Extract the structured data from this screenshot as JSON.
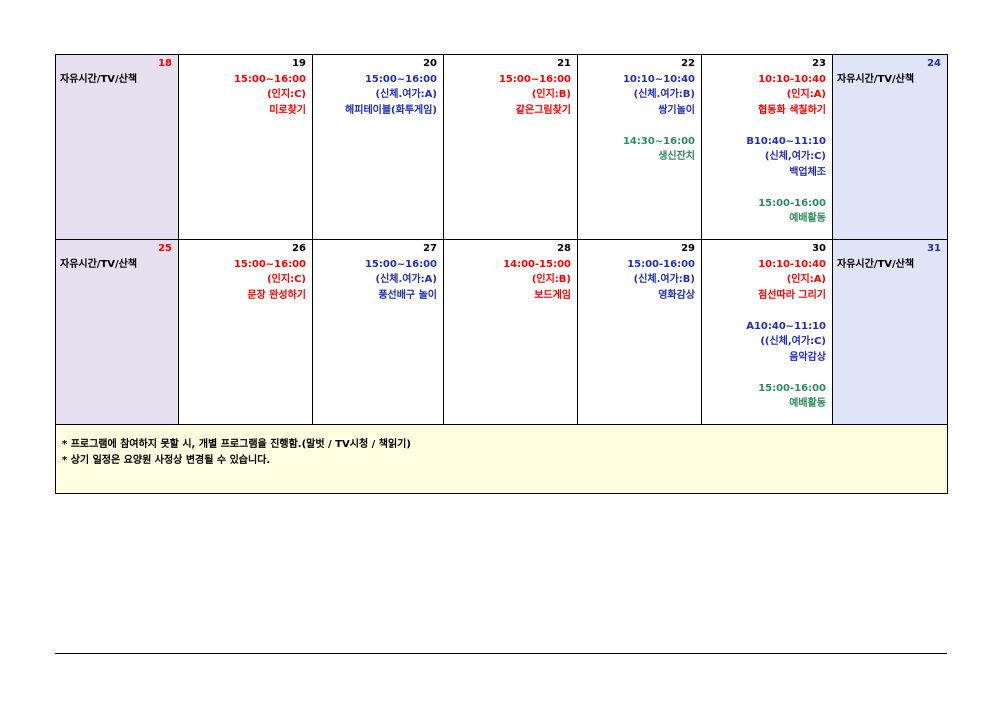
{
  "colors": {
    "red": "#ff0000",
    "blue": "#1f2fb5",
    "green": "#2e8a5a",
    "sunday_bg": "#e6dff0",
    "saturday_bg": "#dfe4f7",
    "note_bg": "#fdfde0"
  },
  "weeks": [
    {
      "days": [
        {
          "num": "18",
          "num_color": "#ff0000",
          "type": "sun",
          "lines": [
            {
              "text": "자유시간/TV/산책",
              "color": "#000000"
            }
          ]
        },
        {
          "num": "19",
          "num_color": "#000000",
          "type": "day",
          "lines": [
            {
              "text": "15:00~16:00",
              "color": "#ff0000"
            },
            {
              "text": "(인지:C)",
              "color": "#ff0000"
            },
            {
              "text": "미로찾기",
              "color": "#ff0000"
            }
          ]
        },
        {
          "num": "20",
          "num_color": "#000000",
          "type": "day",
          "lines": [
            {
              "text": "15:00~16:00",
              "color": "#1f2fb5"
            },
            {
              "text": "(신체.여가:A)",
              "color": "#1f2fb5"
            },
            {
              "text": "해피테이블(화투게임)",
              "color": "#1f2fb5"
            }
          ]
        },
        {
          "num": "21",
          "num_color": "#000000",
          "type": "day",
          "lines": [
            {
              "text": "15:00~16:00",
              "color": "#ff0000"
            },
            {
              "text": "(인지:B)",
              "color": "#ff0000"
            },
            {
              "text": "같은그림찾기",
              "color": "#ff0000"
            }
          ]
        },
        {
          "num": "22",
          "num_color": "#000000",
          "type": "day",
          "lines": [
            {
              "text": "10:10~10:40",
              "color": "#1f2fb5"
            },
            {
              "text": "(신체.여가:B)",
              "color": "#1f2fb5"
            },
            {
              "text": "쌍기놀이",
              "color": "#1f2fb5"
            },
            {
              "text": "",
              "color": "#000000"
            },
            {
              "text": "14:30~16:00",
              "color": "#2e8a5a"
            },
            {
              "text": "생신잔치",
              "color": "#2e8a5a"
            }
          ]
        },
        {
          "num": "23",
          "num_color": "#000000",
          "type": "day",
          "lines": [
            {
              "text": "10:10-10:40",
              "color": "#ff0000"
            },
            {
              "text": "(인지:A)",
              "color": "#ff0000"
            },
            {
              "text": "협동화 색칠하기",
              "color": "#ff0000"
            },
            {
              "text": "",
              "color": "#000000"
            },
            {
              "text": "B10:40~11:10",
              "color": "#1f2fb5"
            },
            {
              "text": "(신체,여가:C)",
              "color": "#1f2fb5"
            },
            {
              "text": "백업체조",
              "color": "#1f2fb5"
            },
            {
              "text": "",
              "color": "#000000"
            },
            {
              "text": "15:00-16:00",
              "color": "#2e8a5a"
            },
            {
              "text": "예배활동",
              "color": "#2e8a5a"
            }
          ]
        },
        {
          "num": "24",
          "num_color": "#1f2fb5",
          "type": "sat",
          "lines": [
            {
              "text": "자유시간/TV/산책",
              "color": "#000000"
            }
          ]
        }
      ]
    },
    {
      "days": [
        {
          "num": "25",
          "num_color": "#ff0000",
          "type": "sun",
          "lines": [
            {
              "text": "자유시간/TV/산책",
              "color": "#000000"
            }
          ]
        },
        {
          "num": "26",
          "num_color": "#000000",
          "type": "day",
          "lines": [
            {
              "text": "15:00~16:00",
              "color": "#ff0000"
            },
            {
              "text": "(인지:C)",
              "color": "#ff0000"
            },
            {
              "text": "문장 완성하기",
              "color": "#ff0000"
            }
          ]
        },
        {
          "num": "27",
          "num_color": "#000000",
          "type": "day",
          "lines": [
            {
              "text": "15:00~16:00",
              "color": "#1f2fb5"
            },
            {
              "text": "(신체.여가:A)",
              "color": "#1f2fb5"
            },
            {
              "text": "풍선배구 놀이",
              "color": "#1f2fb5"
            }
          ]
        },
        {
          "num": "28",
          "num_color": "#000000",
          "type": "day",
          "lines": [
            {
              "text": "14:00-15:00",
              "color": "#ff0000"
            },
            {
              "text": "(인지:B)",
              "color": "#ff0000"
            },
            {
              "text": "보드게임",
              "color": "#ff0000"
            }
          ]
        },
        {
          "num": "29",
          "num_color": "#000000",
          "type": "day",
          "lines": [
            {
              "text": "15:00-16:00",
              "color": "#1f2fb5"
            },
            {
              "text": "(신체.여가:B)",
              "color": "#1f2fb5"
            },
            {
              "text": "영화감상",
              "color": "#1f2fb5"
            }
          ]
        },
        {
          "num": "30",
          "num_color": "#000000",
          "type": "day",
          "lines": [
            {
              "text": "10:10-10:40",
              "color": "#ff0000"
            },
            {
              "text": "(인지:A)",
              "color": "#ff0000"
            },
            {
              "text": "점선따라 그리기",
              "color": "#ff0000"
            },
            {
              "text": "",
              "color": "#000000"
            },
            {
              "text": "A10:40~11:10",
              "color": "#1f2fb5"
            },
            {
              "text": "((신체,여가:C)",
              "color": "#1f2fb5"
            },
            {
              "text": "음악감상",
              "color": "#1f2fb5"
            },
            {
              "text": "",
              "color": "#000000"
            },
            {
              "text": "15:00-16:00",
              "color": "#2e8a5a"
            },
            {
              "text": "예배활동",
              "color": "#2e8a5a"
            }
          ]
        },
        {
          "num": "31",
          "num_color": "#1f2fb5",
          "type": "sat",
          "lines": [
            {
              "text": "자유시간/TV/산책",
              "color": "#000000"
            }
          ]
        }
      ]
    }
  ],
  "notes": [
    "* 프로그램에 참여하지 못할 시, 개별 프로그램을 진행함.(말벗 / TV시청 / 책읽기)",
    "* 상기 일정은 요양원 사정상 변경될 수 있습니다."
  ]
}
